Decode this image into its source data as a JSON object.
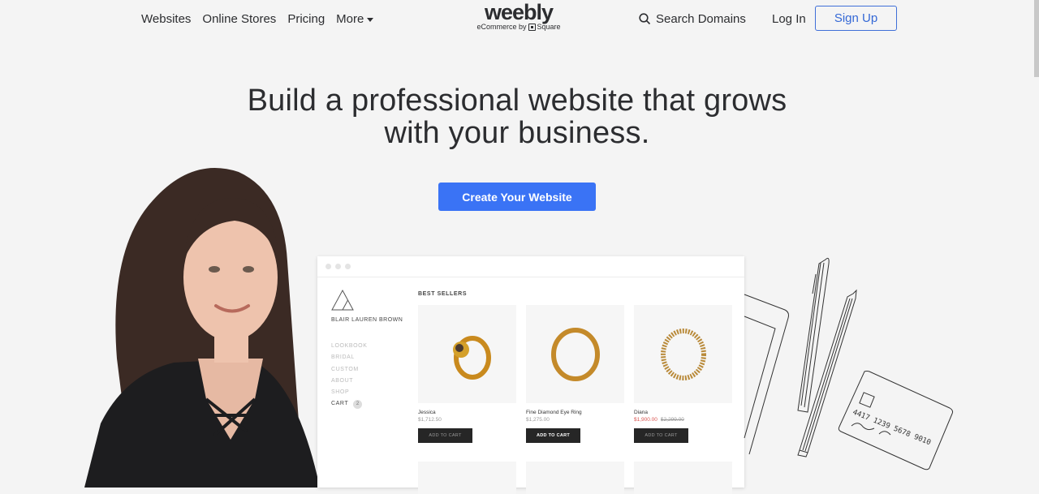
{
  "nav": {
    "links": [
      "Websites",
      "Online Stores",
      "Pricing",
      "More"
    ],
    "logo": {
      "wordmark": "weebly",
      "tagline_prefix": "eCommerce by",
      "tagline_brand": "Square"
    },
    "search_label": "Search Domains",
    "login_label": "Log In",
    "signup_label": "Sign Up"
  },
  "hero": {
    "headline_line1": "Build a professional website that grows",
    "headline_line2": "with your business.",
    "cta_label": "Create Your Website",
    "cta_color": "#3a73f5"
  },
  "mockup": {
    "brand_name": "BLAIR LAUREN BROWN",
    "nav_items": [
      "LOOKBOOK",
      "BRIDAL",
      "CUSTOM",
      "ABOUT",
      "SHOP"
    ],
    "cart_label": "CART",
    "cart_count": "2",
    "section_title": "BEST SELLERS",
    "products": [
      {
        "name": "Jessica",
        "price": "$1,712.50",
        "button": "ADD TO CART"
      },
      {
        "name": "Fine Diamond Eye Ring",
        "price": "$1,275.00",
        "button": "ADD TO CART"
      },
      {
        "name": "Diana",
        "sale_price": "$1,900.00",
        "original_price": "$2,299.00",
        "button": "ADD TO CART"
      }
    ]
  },
  "illustration": {
    "card_number": "4417 1239 5678 9010"
  }
}
